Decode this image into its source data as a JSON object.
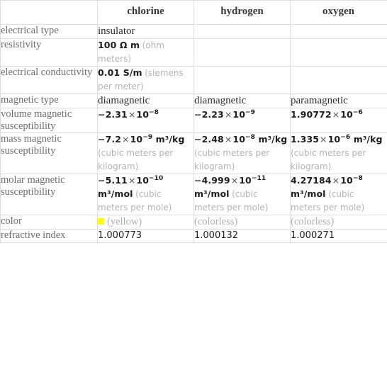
{
  "table": {
    "columns": [
      "",
      "chlorine",
      "hydrogen",
      "oxygen"
    ],
    "headers": {
      "col1": "chlorine",
      "col2": "hydrogen",
      "col3": "oxygen"
    },
    "rows": [
      {
        "label": "electrical type",
        "cells": [
          {
            "kind": "text",
            "value": "insulator"
          },
          {
            "kind": "empty",
            "value": ""
          },
          {
            "kind": "empty",
            "value": ""
          }
        ]
      },
      {
        "label": "resistivity",
        "cells": [
          {
            "kind": "quantity",
            "value": "100 Ω m",
            "unit_note": "(ohm meters)"
          },
          {
            "kind": "empty",
            "value": ""
          },
          {
            "kind": "empty",
            "value": ""
          }
        ]
      },
      {
        "label": "electrical conductivity",
        "cells": [
          {
            "kind": "quantity",
            "value": "0.01 S/m",
            "unit_note": "(siemens per meter)"
          },
          {
            "kind": "empty",
            "value": ""
          },
          {
            "kind": "empty",
            "value": ""
          }
        ]
      },
      {
        "label": "magnetic type",
        "cells": [
          {
            "kind": "text",
            "value": "diamagnetic"
          },
          {
            "kind": "text",
            "value": "diamagnetic"
          },
          {
            "kind": "text",
            "value": "paramagnetic"
          }
        ]
      },
      {
        "label": "volume magnetic susceptibility",
        "cells": [
          {
            "kind": "sci",
            "mantissa": "−2.31",
            "exponent": "−8",
            "suffix": "",
            "unit_note": ""
          },
          {
            "kind": "sci",
            "mantissa": "−2.23",
            "exponent": "−9",
            "suffix": "",
            "unit_note": ""
          },
          {
            "kind": "sci",
            "mantissa": "1.90772",
            "exponent": "−6",
            "suffix": "",
            "unit_note": ""
          }
        ]
      },
      {
        "label": "mass magnetic susceptibility",
        "cells": [
          {
            "kind": "sci",
            "mantissa": "−7.2",
            "exponent": "−9",
            "suffix": " m³/kg",
            "unit_note": "(cubic meters per kilogram)"
          },
          {
            "kind": "sci",
            "mantissa": "−2.48",
            "exponent": "−8",
            "suffix": " m³/kg",
            "unit_note": "(cubic meters per kilogram)"
          },
          {
            "kind": "sci",
            "mantissa": "1.335",
            "exponent": "−6",
            "suffix": " m³/kg",
            "unit_note": "(cubic meters per kilogram)"
          }
        ]
      },
      {
        "label": "molar magnetic susceptibility",
        "cells": [
          {
            "kind": "sci",
            "mantissa": "−5.11",
            "exponent": "−10",
            "suffix": " m³/mol",
            "unit_note": "(cubic meters per mole)"
          },
          {
            "kind": "sci",
            "mantissa": "−4.999",
            "exponent": "−11",
            "suffix": " m³/mol",
            "unit_note": "(cubic meters per mole)"
          },
          {
            "kind": "sci",
            "mantissa": "4.27184",
            "exponent": "−8",
            "suffix": " m³/mol",
            "unit_note": "(cubic meters per mole)"
          }
        ]
      },
      {
        "label": "color",
        "cells": [
          {
            "kind": "color",
            "swatch": "#ffff00",
            "value": "(yellow)"
          },
          {
            "kind": "note",
            "value": "(colorless)"
          },
          {
            "kind": "note",
            "value": "(colorless)"
          }
        ]
      },
      {
        "label": "refractive index",
        "cells": [
          {
            "kind": "plain",
            "value": "1.000773"
          },
          {
            "kind": "plain",
            "value": "1.000132"
          },
          {
            "kind": "plain",
            "value": "1.000271"
          }
        ]
      }
    ]
  },
  "style": {
    "border_color": "#dcdcdc",
    "label_color": "#6e6e6e",
    "value_color": "#1e1e1e",
    "note_color": "#b3b3b3",
    "times_symbol": "×"
  }
}
